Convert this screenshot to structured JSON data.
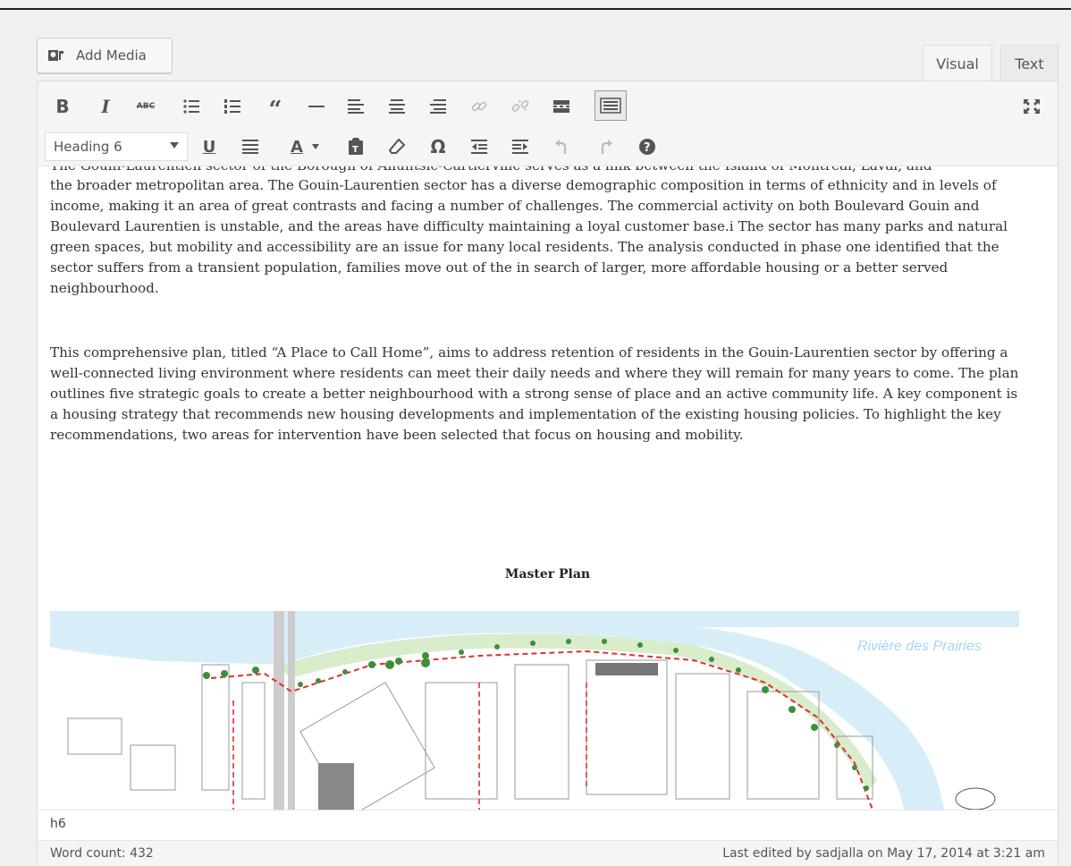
{
  "toolbar_top": {
    "add_media_label": "Add Media"
  },
  "tabs": [
    {
      "label": "Visual"
    },
    {
      "label": "Text"
    }
  ],
  "format": {
    "selected": "Heading 6"
  },
  "content": {
    "paragraph1_cut": "The Gouin-Laurentien sector of the Borough of Ahuntsic-Cartierville serves as a link between the Island of Montreal, Laval, and",
    "paragraph1": "the broader metropolitan area.  The Gouin-Laurentien sector has a diverse demographic composition in terms of ethnicity and in levels of income, making it an area of great contrasts and facing a number of challenges. The commercial activity on both Boulevard Gouin and Boulevard Laurentien is unstable, and the areas have difficulty maintaining a loyal customer base.i The sector has many parks and natural green spaces, but mobility and accessibility are an issue for many local residents. The analysis conducted in phase one identified that the sector suffers from a transient population, families move out of the in search of larger, more affordable housing or a better served neighbourhood.",
    "paragraph2": "This comprehensive plan, titled “A Place to Call Home”, aims to address retention of residents in the Gouin-Laurentien sector by offering a well-connected living environment where residents can meet their daily needs and where they will remain for many years to come. The plan outlines five strategic goals to create a better neighbourhood with a strong sense of place and an active community life.   A key component is a housing strategy that recommends new housing developments and implementation of the existing housing policies. To highlight the key recommendations, two areas for intervention have been selected that focus on housing and mobility.",
    "heading": "Master Plan",
    "map_label": "Rivière des Prairies"
  },
  "status": {
    "path": "h6",
    "word_count": "Word count: 432",
    "last_edited": "Last edited by sadjalla on May 17, 2014 at 3:21 am"
  },
  "icons": [
    "bold-icon",
    "italic-icon",
    "strikethrough-icon",
    "bullet-list-icon",
    "numbered-list-icon",
    "blockquote-icon",
    "horizontal-line-icon",
    "align-left-icon",
    "align-center-icon",
    "align-right-icon",
    "link-icon",
    "unlink-icon",
    "read-more-icon",
    "toolbar-toggle-icon",
    "fullscreen-icon",
    "underline-icon",
    "justify-icon",
    "text-color-icon",
    "paste-text-icon",
    "clear-formatting-icon",
    "special-character-icon",
    "outdent-icon",
    "indent-icon",
    "undo-icon",
    "redo-icon",
    "help-icon"
  ]
}
